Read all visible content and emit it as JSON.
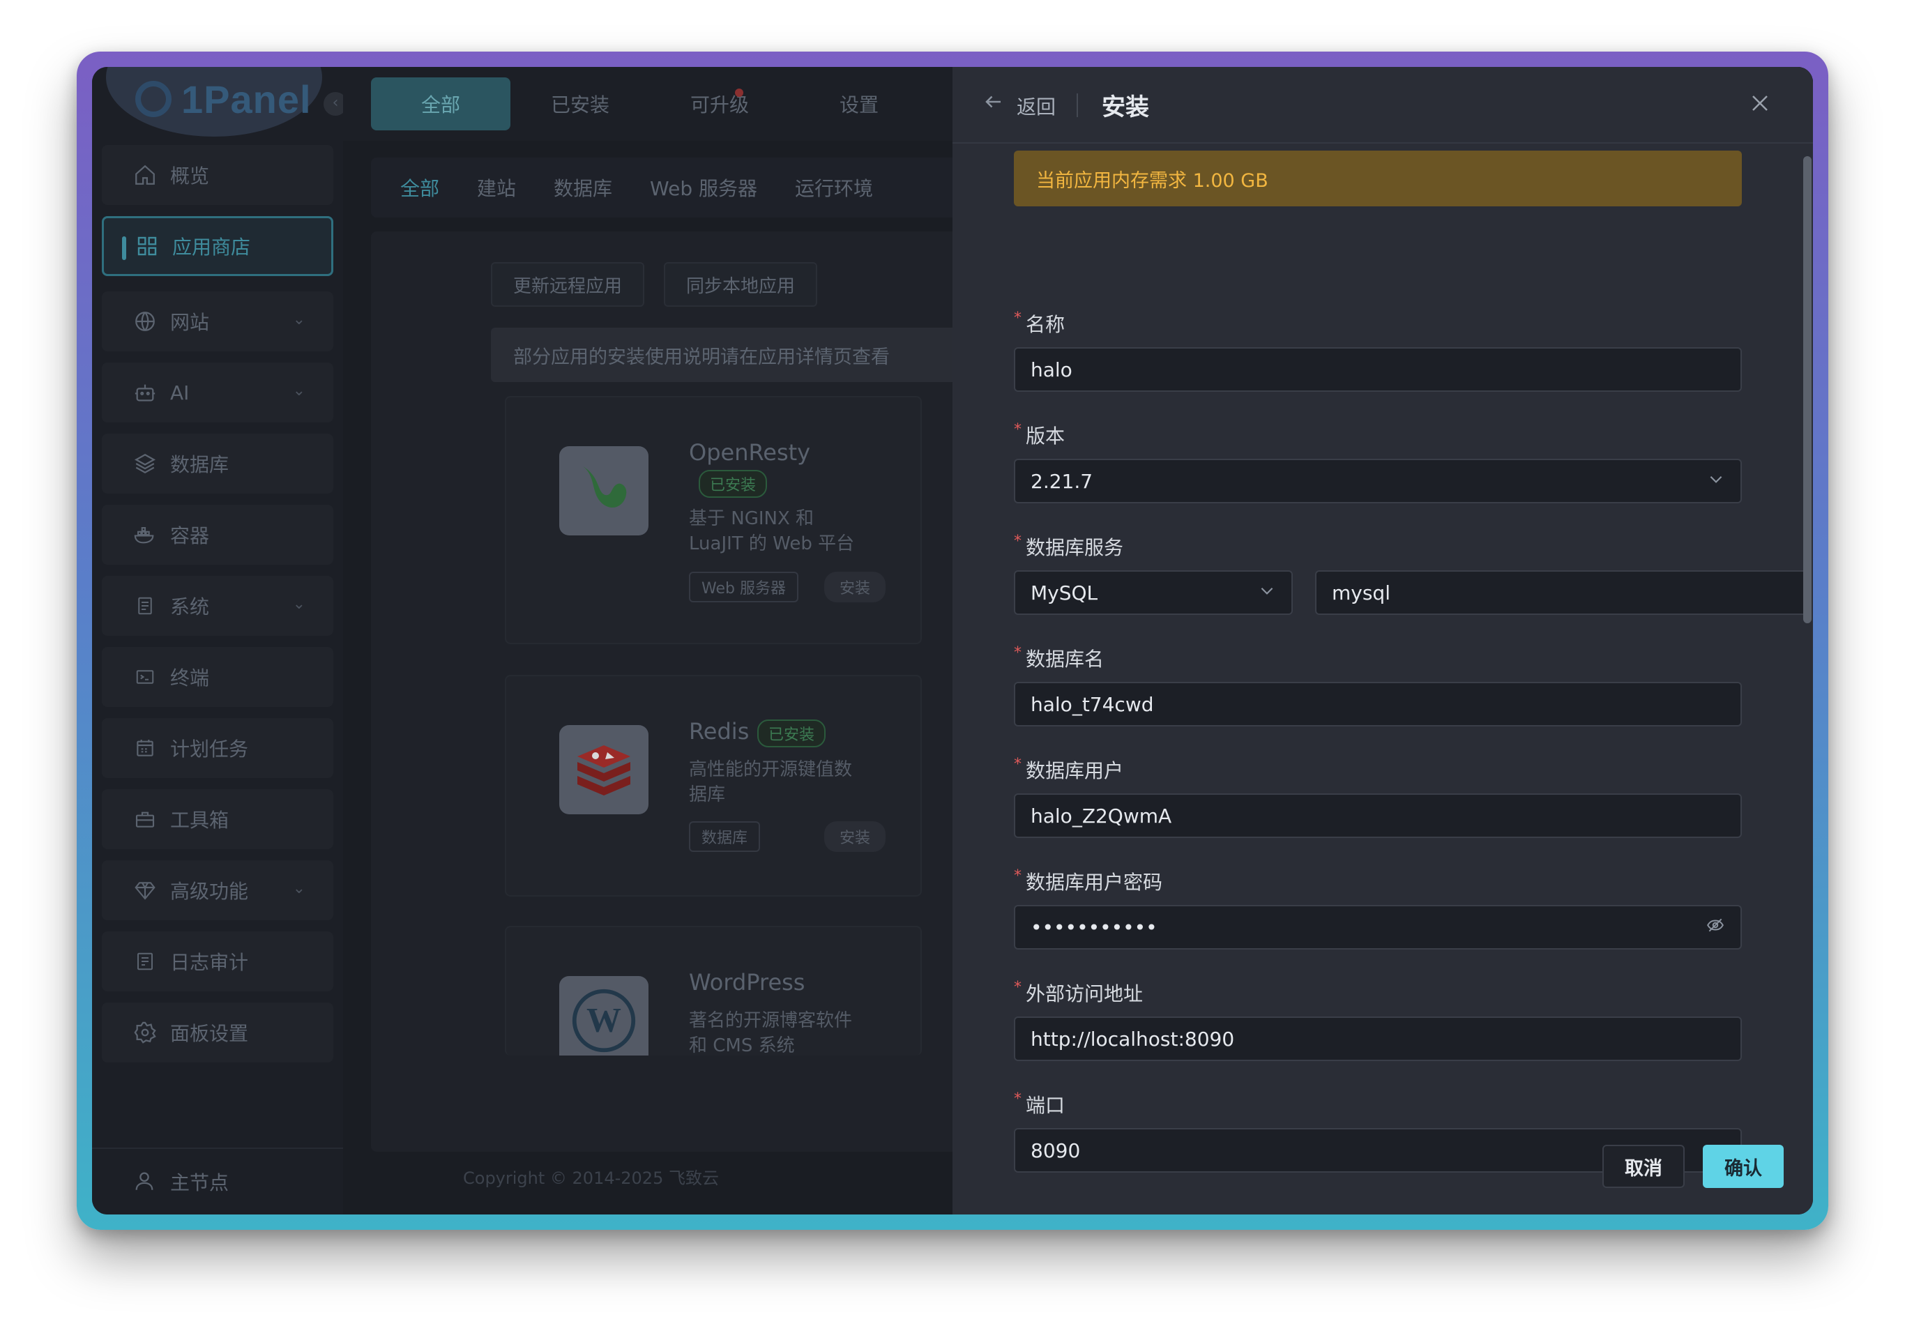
{
  "app": {
    "logo_text": "1Panel",
    "sidebar": {
      "items": [
        {
          "label": "概览",
          "icon": "home-icon",
          "chevron": false
        },
        {
          "label": "应用商店",
          "icon": "grid-icon",
          "chevron": false,
          "active": true
        },
        {
          "label": "网站",
          "icon": "globe-icon",
          "chevron": true
        },
        {
          "label": "AI",
          "icon": "robot-icon",
          "chevron": true
        },
        {
          "label": "数据库",
          "icon": "layers-icon",
          "chevron": false
        },
        {
          "label": "容器",
          "icon": "docker-icon",
          "chevron": false
        },
        {
          "label": "系统",
          "icon": "server-icon",
          "chevron": true
        },
        {
          "label": "终端",
          "icon": "terminal-icon",
          "chevron": false
        },
        {
          "label": "计划任务",
          "icon": "calendar-icon",
          "chevron": false
        },
        {
          "label": "工具箱",
          "icon": "toolbox-icon",
          "chevron": false
        },
        {
          "label": "高级功能",
          "icon": "diamond-icon",
          "chevron": true
        },
        {
          "label": "日志审计",
          "icon": "log-icon",
          "chevron": false
        },
        {
          "label": "面板设置",
          "icon": "gear-icon",
          "chevron": false
        }
      ],
      "node_label": "主节点"
    },
    "top_tabs": [
      "全部",
      "已安装",
      "可升级",
      "设置"
    ],
    "categories": [
      "全部",
      "建站",
      "数据库",
      "Web 服务器",
      "运行环境"
    ],
    "actions": {
      "update_remote": "更新远程应用",
      "sync_local": "同步本地应用"
    },
    "notice": "部分应用的安装使用说明请在应用详情页查看",
    "cards": [
      {
        "name": "OpenResty",
        "badge": "已安装",
        "desc_line1": "基于 NGINX 和",
        "desc_line2": "LuaJIT 的 Web 平台",
        "tag": "Web 服务器",
        "install": "安装"
      },
      {
        "name": "Redis",
        "badge": "已安装",
        "desc_line1": "高性能的开源键值数",
        "desc_line2": "据库",
        "tag": "数据库",
        "install": "安装"
      },
      {
        "name": "WordPress",
        "desc_line1": "著名的开源博客软件",
        "desc_line2": "和 CMS 系统"
      }
    ],
    "copyright": "Copyright © 2014-2025 飞致云"
  },
  "drawer": {
    "back_label": "返回",
    "title": "安装",
    "memory_alert": "当前应用内存需求 1.00 GB",
    "fields": {
      "name": {
        "label": "名称",
        "value": "halo"
      },
      "version": {
        "label": "版本",
        "value": "2.21.7"
      },
      "db_service": {
        "label": "数据库服务",
        "type_value": "MySQL",
        "instance_value": "mysql"
      },
      "db_name": {
        "label": "数据库名",
        "value": "halo_t74cwd"
      },
      "db_user": {
        "label": "数据库用户",
        "value": "halo_Z2QwmA"
      },
      "db_password": {
        "label": "数据库用户密码",
        "value": "•••••••••••"
      },
      "external_url": {
        "label": "外部访问地址",
        "value": "http://localhost:8090"
      },
      "port": {
        "label": "端口",
        "value": "8090"
      }
    },
    "required_mark": "*",
    "cancel_label": "取消",
    "confirm_label": "确认"
  },
  "colors": {
    "accent": "#5fd3e6",
    "alert_bg": "#6b5524",
    "alert_text": "#f2b640",
    "required": "#e05a5a"
  }
}
